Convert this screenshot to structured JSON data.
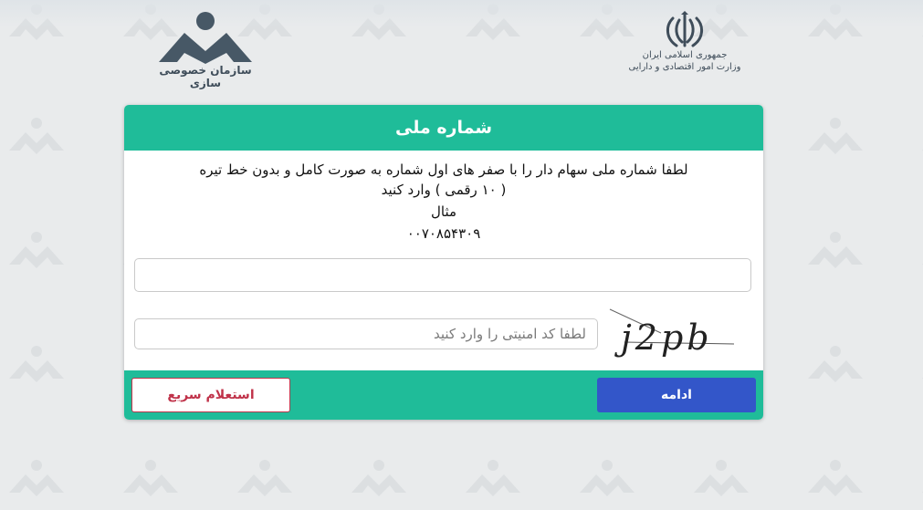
{
  "header": {
    "left_logo": {
      "icon": "privatization-org-logo",
      "caption": "سازمان خصوصی سازی"
    },
    "right_logo": {
      "icon": "iran-emblem-logo",
      "caption_line1": "جمهوری اسلامی ایران",
      "caption_line2": "وزارت امور اقتصادی و دارایی"
    }
  },
  "card": {
    "title": "شماره ملی",
    "instruction_line1": "لطفا شماره ملی سهام دار را با صفر های اول شماره به صورت کامل و بدون خط تیره",
    "instruction_line2": "( ۱۰ رقمی ) وارد کنید",
    "example_label": "مثال",
    "example_value": "۰۰۷۰۸۵۴۳۰۹",
    "national_id": {
      "value": "",
      "placeholder": ""
    },
    "captcha": {
      "placeholder": "لطفا کد امنیتی را وارد کنید",
      "image_text": "j2pb"
    },
    "buttons": {
      "continue": "ادامه",
      "quick_inquiry": "استعلام سریع"
    }
  },
  "colors": {
    "accent": "#1fbc99",
    "primary_button": "#3356c9",
    "secondary_button_text": "#c0334a",
    "background": "#e9ebec"
  }
}
